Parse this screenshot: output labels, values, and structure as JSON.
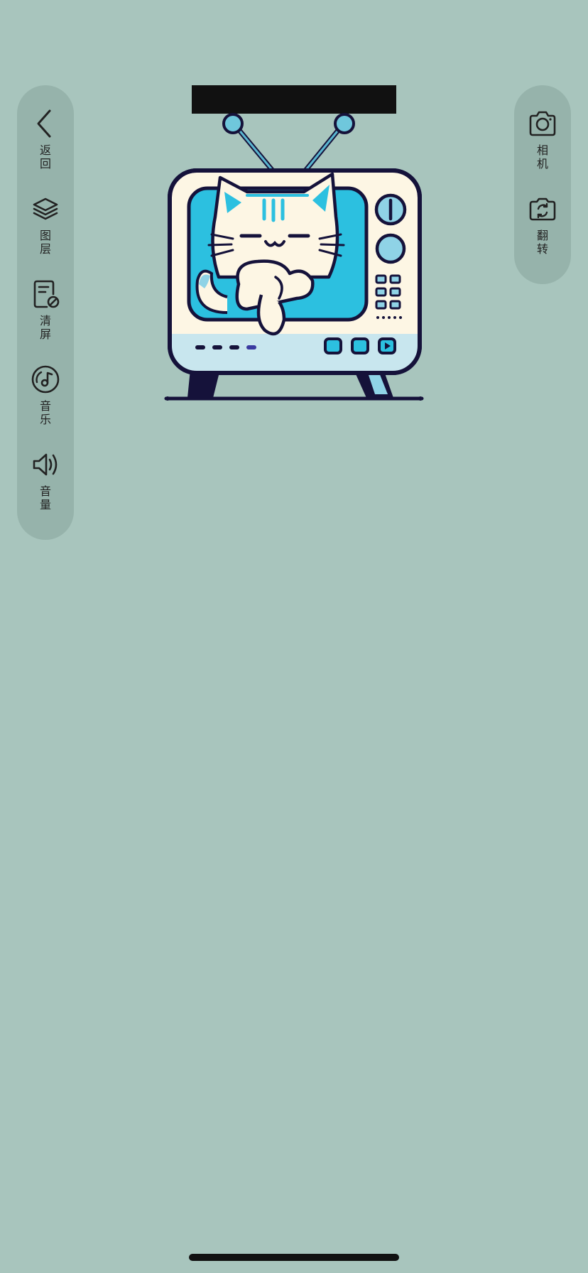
{
  "left_toolbar": {
    "items": [
      {
        "id": "back",
        "label": "返回",
        "icon": "chevron-left-icon"
      },
      {
        "id": "layers",
        "label": "图层",
        "icon": "layers-icon"
      },
      {
        "id": "clear",
        "label": "清屏",
        "icon": "clear-screen-icon"
      },
      {
        "id": "music",
        "label": "音乐",
        "icon": "music-disc-icon"
      },
      {
        "id": "volume",
        "label": "音量",
        "icon": "speaker-icon"
      }
    ]
  },
  "right_toolbar": {
    "items": [
      {
        "id": "camera",
        "label": "相机",
        "icon": "camera-icon"
      },
      {
        "id": "flip",
        "label": "翻转",
        "icon": "camera-flip-icon"
      }
    ]
  },
  "colors": {
    "background": "#a8c5bd",
    "panel": "#96b3ab",
    "tv_body": "#fdf6e4",
    "tv_screen": "#2cc0e0",
    "outline": "#15123a"
  }
}
